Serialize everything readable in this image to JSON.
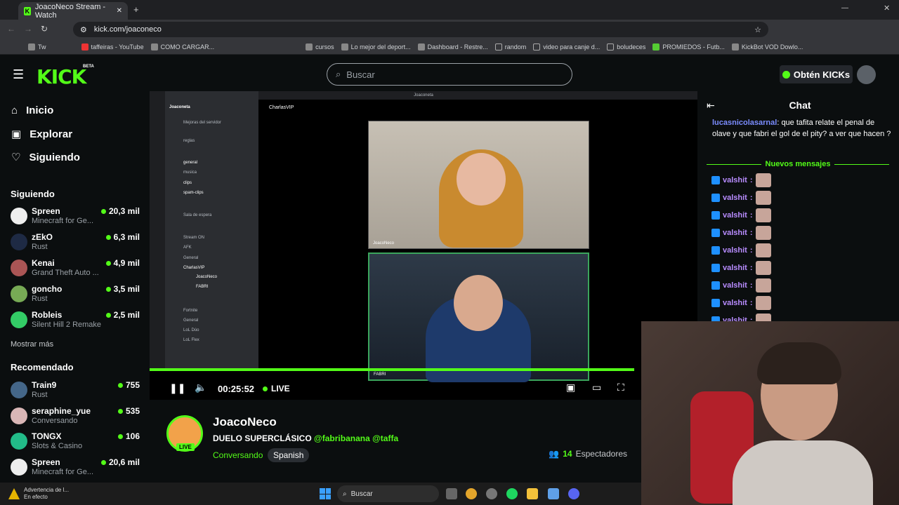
{
  "browser": {
    "tab_title": "JoacoNeco Stream - Watch",
    "url": "kick.com/joaconeco",
    "bookmarks": [
      "Tw",
      "taffeiras - YouTube",
      "COMO CARGAR...",
      "cursos",
      "Lo mejor del deport...",
      "Dashboard - Restre...",
      "random",
      "video para canje d...",
      "boludeces",
      "PROMIEDOS - Futb...",
      "KickBot VOD Dowlo..."
    ]
  },
  "header": {
    "logo": "KICK",
    "beta": "BETA",
    "search_placeholder": "Buscar",
    "obtain_label": "Obtén KICKs"
  },
  "sidebar": {
    "nav": [
      {
        "label": "Inicio",
        "icon": "home-icon"
      },
      {
        "label": "Explorar",
        "icon": "compass-icon"
      },
      {
        "label": "Siguiendo",
        "icon": "heart-icon"
      }
    ],
    "following_title": "Siguiendo",
    "following": [
      {
        "name": "Spreen",
        "category": "Minecraft for Ge...",
        "viewers": "20,3 mil"
      },
      {
        "name": "zEkO",
        "category": "Rust",
        "viewers": "6,3 mil"
      },
      {
        "name": "Kenai",
        "category": "Grand Theft Auto ...",
        "viewers": "4,9 mil"
      },
      {
        "name": "goncho",
        "category": "Rust",
        "viewers": "3,5 mil"
      },
      {
        "name": "Robleis",
        "category": "Silent Hill 2 Remake",
        "viewers": "2,5 mil"
      }
    ],
    "show_more": "Mostrar más",
    "recommended_title": "Recomendado",
    "recommended": [
      {
        "name": "Train9",
        "category": "Rust",
        "viewers": "755"
      },
      {
        "name": "seraphine_yue",
        "category": "Conversando",
        "viewers": "535"
      },
      {
        "name": "TONGX",
        "category": "Slots & Casino",
        "viewers": "106"
      },
      {
        "name": "Spreen",
        "category": "Minecraft for Ge...",
        "viewers": "20,6 mil"
      }
    ]
  },
  "player": {
    "time": "00:25:52",
    "live": "LIVE",
    "discord_channel": "CharlasVIP",
    "discord_window": "Joaconeta",
    "server_name": "Joaconeta",
    "cam1_label": "JoacoNeco",
    "cam2_label": "FABRI",
    "discord_items": [
      "Mejoras del servidor",
      "reglas",
      "general",
      "musica",
      "clips",
      "spam-clips",
      "Sala de espera",
      "Stream ON",
      "AFK",
      "General",
      "CharlasVIP",
      "JoacoNeco",
      "FABRI",
      "Fortnite",
      "General",
      "LoL Dúo",
      "LoL Flex"
    ],
    "progress": 1.0
  },
  "stream": {
    "name": "JoacoNeco",
    "title_prefix": "DUELO SUPERCLÁSICO",
    "mentions": "@fabribanana @taffa",
    "category": "Conversando",
    "tag": "Spanish",
    "viewers_count": "14",
    "viewers_label": "Espectadores",
    "live_badge": "LIVE"
  },
  "chat": {
    "title": "Chat",
    "first_user": "lucasnicolasarnal",
    "first_message": ": que tafita relate el penal de olave y que fabri el gol de el pity? a ver que hacen ?",
    "new_messages": "Nuevos mensajes",
    "repeated_user": "valshit",
    "repeated_count": 9
  },
  "taskbar": {
    "warning_title": "Advertencia de l...",
    "warning_sub": "En efecto",
    "search": "Buscar"
  },
  "colors": {
    "accent": "#53fc18",
    "background": "#0b0e0f"
  }
}
